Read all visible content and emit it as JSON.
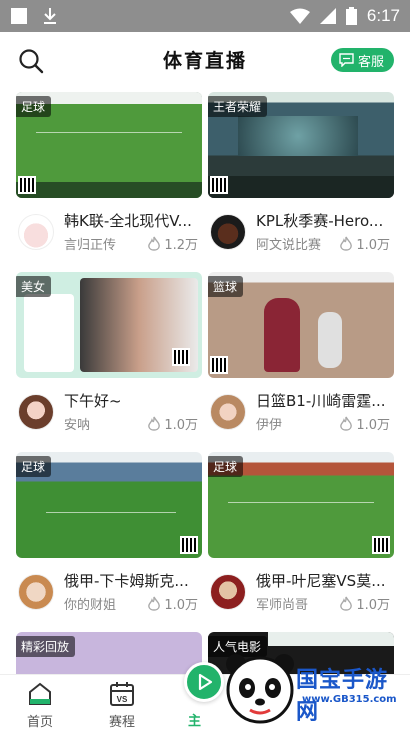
{
  "status_bar": {
    "time": "6:17"
  },
  "header": {
    "title": "体育直播",
    "service_label": "客服"
  },
  "cards": [
    {
      "tag": "足球",
      "title": "韩K联-全北现代V...",
      "author": "言归正传",
      "heat": "1.2万"
    },
    {
      "tag": "王者荣耀",
      "title": "KPL秋季赛-Hero...",
      "author": "阿文说比赛",
      "heat": "1.0万"
    },
    {
      "tag": "美女",
      "title": "下午好~",
      "author": "安呐",
      "heat": "1.0万"
    },
    {
      "tag": "篮球",
      "title": "日篮B1-川崎雷霆...",
      "author": "伊伊",
      "heat": "1.0万"
    },
    {
      "tag": "足球",
      "title": "俄甲-下卡姆斯克...",
      "author": "你的财姐",
      "heat": "1.0万"
    },
    {
      "tag": "足球",
      "title": "俄甲-叶尼塞VS莫...",
      "author": "军师尚哥",
      "heat": "1.0万"
    },
    {
      "tag": "精彩回放"
    },
    {
      "tag": "人气电影"
    }
  ],
  "tabbar": {
    "home": "首页",
    "schedule": "赛程",
    "live": "主"
  },
  "watermark": {
    "brand": "国宝手游网",
    "url": "www.GB315.com"
  },
  "colors": {
    "accent": "#22b36b",
    "status_bar": "#8e8e8e",
    "watermark_blue": "#1a57c9"
  }
}
